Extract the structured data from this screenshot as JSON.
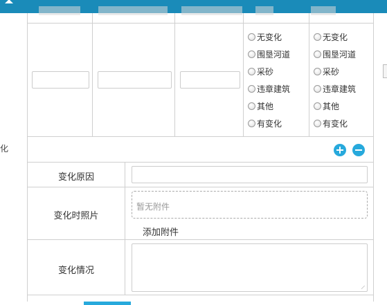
{
  "left_stub": {
    "text": "化"
  },
  "options_col1": [
    "无变化",
    "围垦河道",
    "采砂",
    "违章建筑",
    "其他",
    "有变化"
  ],
  "options_col2": [
    "无变化",
    "围垦河道",
    "采砂",
    "违章建筑",
    "其他",
    "有变化"
  ],
  "rows": {
    "reason_label": "变化原因",
    "photo_label": "变化时照片",
    "status_label": "变化情况"
  },
  "attachment": {
    "empty_text": "暂无附件",
    "add_label": "添加附件"
  },
  "colors": {
    "header_bar": "#1a8bb9",
    "accent": "#27a9dc",
    "border": "#cfcfcf"
  },
  "icons": [
    "add-icon",
    "remove-icon",
    "chevron-up-icon",
    "resize-grip-icon"
  ]
}
